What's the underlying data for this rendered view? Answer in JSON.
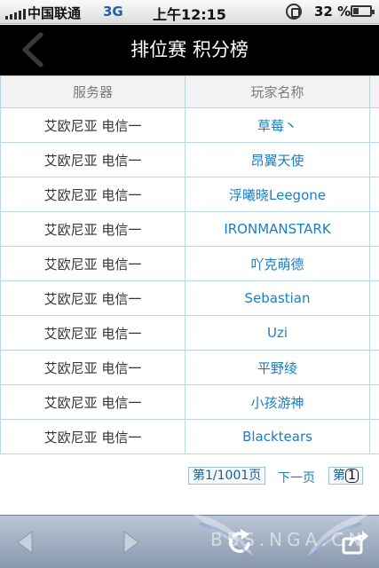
{
  "status_bar": {
    "carrier": "中国联通",
    "network": "3G",
    "time": "上午12:15",
    "battery": "32 %"
  },
  "nav": {
    "title": "排位赛 积分榜",
    "back_icon": "chevron-left-icon"
  },
  "table": {
    "headers": [
      "服务器",
      "玩家名称"
    ],
    "rows": [
      {
        "server": "艾欧尼亚 电信一",
        "player": "草莓丶"
      },
      {
        "server": "艾欧尼亚 电信一",
        "player": "昂翼天使"
      },
      {
        "server": "艾欧尼亚 电信一",
        "player": "浮曦晓Leegone"
      },
      {
        "server": "艾欧尼亚 电信一",
        "player": "IRONMANSTARK"
      },
      {
        "server": "艾欧尼亚 电信一",
        "player": "吖克萌德"
      },
      {
        "server": "艾欧尼亚 电信一",
        "player": "Sebastian"
      },
      {
        "server": "艾欧尼亚 电信一",
        "player": "Uzi"
      },
      {
        "server": "艾欧尼亚 电信一",
        "player": "平野绫"
      },
      {
        "server": "艾欧尼亚 电信一",
        "player": "小孩游神"
      },
      {
        "server": "艾欧尼亚 电信一",
        "player": "Blacktears"
      }
    ]
  },
  "pager": {
    "page_info": "第1/1001页",
    "next": "下一页",
    "jump_prefix": "第",
    "jump_value": "1"
  },
  "toolbar": {
    "icons": [
      "back-arrow-icon",
      "forward-arrow-icon",
      "reload-icon",
      "share-icon"
    ]
  },
  "watermark": {
    "text": "BBS.NGA.CN"
  },
  "colors": {
    "title_bar": "#000000",
    "player_text": "#1a7ec2",
    "grid": "#b9d7e8",
    "toolbar": "#9aa8bc"
  }
}
